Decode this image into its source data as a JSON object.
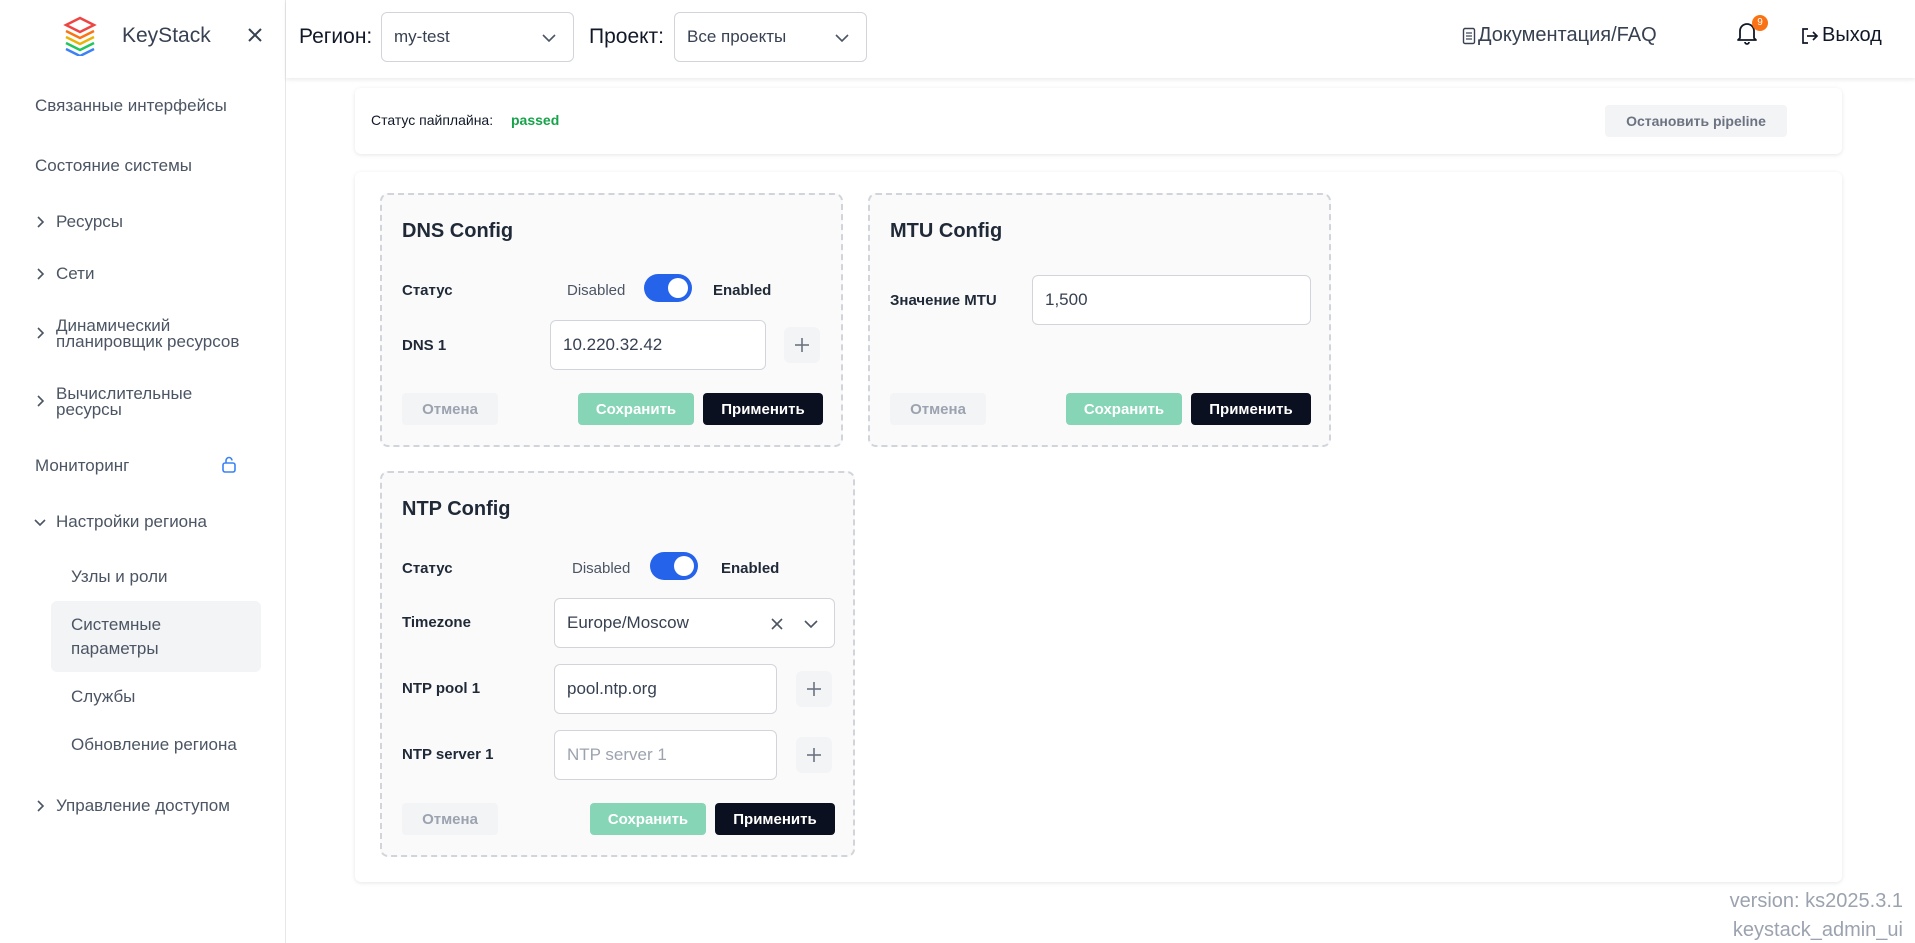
{
  "brand": {
    "name": "KeyStack"
  },
  "sidebar": {
    "items": [
      {
        "label": "Связанные интерфейсы"
      },
      {
        "label": "Состояние системы"
      },
      {
        "label": "Ресурсы"
      },
      {
        "label": "Сети"
      },
      {
        "label": "Динамический планировщик ресурсов"
      },
      {
        "label": "Вычислительные ресурсы"
      },
      {
        "label": "Мониторинг"
      },
      {
        "label": "Настройки региона"
      },
      {
        "label": "Управление доступом"
      }
    ],
    "subitems": [
      {
        "label": "Узлы и роли"
      },
      {
        "label": "Системные параметры"
      },
      {
        "label": "Службы"
      },
      {
        "label": "Обновление региона"
      }
    ]
  },
  "header": {
    "region_label": "Регион:",
    "region_value": "my-test",
    "project_label": "Проект:",
    "project_value": "Все проекты",
    "docs": "Документация/FAQ",
    "notifications_count": "9",
    "logout": "Выход"
  },
  "pipeline": {
    "status_label": "Статус пайплайна:",
    "status_value": "passed",
    "stop_button": "Остановить pipeline"
  },
  "dns": {
    "title": "DNS Config",
    "status_label": "Статус",
    "disabled": "Disabled",
    "enabled": "Enabled",
    "dns1_label": "DNS 1",
    "dns1_value": "10.220.32.42",
    "cancel": "Отмена",
    "save": "Сохранить",
    "apply": "Применить"
  },
  "mtu": {
    "title": "MTU Config",
    "value_label": "Значение MTU",
    "value": "1,500",
    "cancel": "Отмена",
    "save": "Сохранить",
    "apply": "Применить"
  },
  "ntp": {
    "title": "NTP Config",
    "status_label": "Статус",
    "disabled": "Disabled",
    "enabled": "Enabled",
    "timezone_label": "Timezone",
    "timezone_value": "Europe/Moscow",
    "pool_label": "NTP pool 1",
    "pool_value": "pool.ntp.org",
    "server_label": "NTP server 1",
    "server_placeholder": "NTP server 1",
    "cancel": "Отмена",
    "save": "Сохранить",
    "apply": "Применить"
  },
  "version": {
    "line1": "version: ks2025.3.1",
    "line2": "keystack_admin_ui"
  },
  "colors": {
    "toggle_on": "#2563eb",
    "status_passed": "#16a34a",
    "save_disabled": "#86d5b7",
    "apply": "#0b1020",
    "badge": "#f97316"
  }
}
